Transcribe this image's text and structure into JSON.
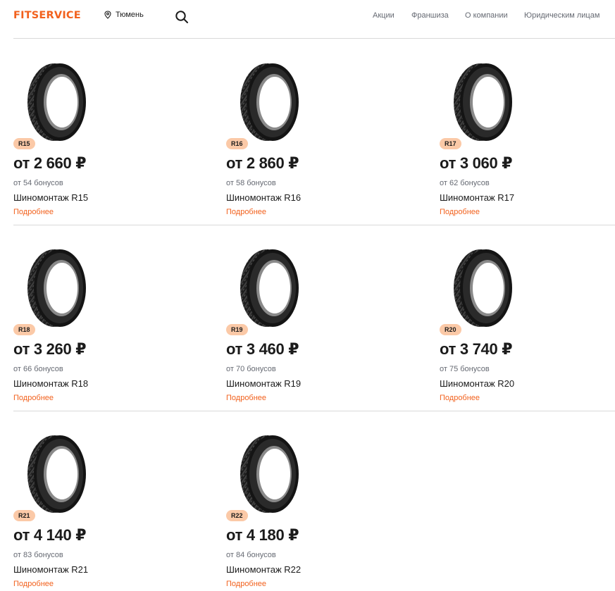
{
  "header": {
    "logo": "FITSERVICE",
    "city": "Тюмень",
    "nav": [
      "Акции",
      "Франшиза",
      "О компании",
      "Юридическим лицам"
    ]
  },
  "colors": {
    "accent": "#f2611d",
    "badge_bg": "#fbc9a7",
    "muted": "#666a73",
    "text": "#1b1b1b",
    "divider": "#d9d9d9"
  },
  "products": [
    {
      "size": "R15",
      "price": "от 2 660 ₽",
      "bonus": "от 54 бонусов",
      "name": "Шиномонтаж R15",
      "more": "Подробнее"
    },
    {
      "size": "R16",
      "price": "от 2 860 ₽",
      "bonus": "от 58 бонусов",
      "name": "Шиномонтаж R16",
      "more": "Подробнее"
    },
    {
      "size": "R17",
      "price": "от 3 060 ₽",
      "bonus": "от 62 бонусов",
      "name": "Шиномонтаж R17",
      "more": "Подробнее"
    },
    {
      "size": "R18",
      "price": "от 3 260 ₽",
      "bonus": "от 66 бонусов",
      "name": "Шиномонтаж R18",
      "more": "Подробнее"
    },
    {
      "size": "R19",
      "price": "от 3 460 ₽",
      "bonus": "от 70 бонусов",
      "name": "Шиномонтаж R19",
      "more": "Подробнее"
    },
    {
      "size": "R20",
      "price": "от 3 740 ₽",
      "bonus": "от 75 бонусов",
      "name": "Шиномонтаж R20",
      "more": "Подробнее"
    },
    {
      "size": "R21",
      "price": "от 4 140 ₽",
      "bonus": "от 83 бонусов",
      "name": "Шиномонтаж R21",
      "more": "Подробнее"
    },
    {
      "size": "R22",
      "price": "от 4 180 ₽",
      "bonus": "от 84 бонусов",
      "name": "Шиномонтаж R22",
      "more": "Подробнее"
    }
  ]
}
